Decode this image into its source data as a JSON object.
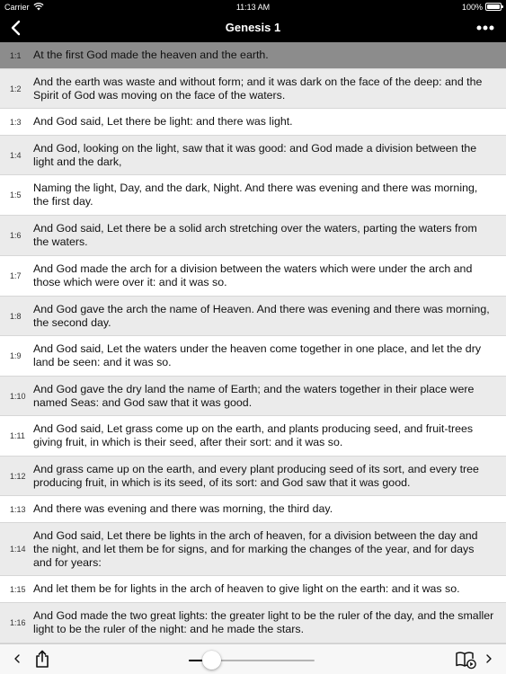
{
  "status_bar": {
    "carrier": "Carrier",
    "time": "11:13 AM",
    "battery": "100%"
  },
  "nav": {
    "title": "Genesis 1",
    "back_icon": "chevron-left-icon",
    "more_icon": "ellipsis-icon"
  },
  "verses": [
    {
      "ref": "1:1",
      "text": "At the first God made the heaven and the earth."
    },
    {
      "ref": "1:2",
      "text": "And the earth was waste and without form; and it was dark on the face of the deep: and the Spirit of God was moving on the face of the waters."
    },
    {
      "ref": "1:3",
      "text": "And God said, Let there be light: and there was light."
    },
    {
      "ref": "1:4",
      "text": "And God, looking on the light, saw that it was good: and God made a division between the light and the dark,"
    },
    {
      "ref": "1:5",
      "text": "Naming the light, Day, and the dark, Night. And there was evening and there was morning, the first day."
    },
    {
      "ref": "1:6",
      "text": "And God said, Let there be a solid arch stretching over the waters, parting the waters from the waters."
    },
    {
      "ref": "1:7",
      "text": "And God made the arch for a division between the waters which were under the arch and those which were over it: and it was so."
    },
    {
      "ref": "1:8",
      "text": "And God gave the arch the name of Heaven. And there was evening and there was morning, the second day."
    },
    {
      "ref": "1:9",
      "text": "And God said, Let the waters under the heaven come together in one place, and let the dry land be seen: and it was so."
    },
    {
      "ref": "1:10",
      "text": "And God gave the dry land the name of Earth; and the waters together in their place were named Seas: and God saw that it was good."
    },
    {
      "ref": "1:11",
      "text": "And God said, Let grass come up on the earth, and plants producing seed, and fruit-trees giving fruit, in which is their seed, after their sort: and it was so."
    },
    {
      "ref": "1:12",
      "text": "And grass came up on the earth, and every plant producing seed of its sort, and every tree producing fruit, in which is its seed, of its sort: and God saw that it was good."
    },
    {
      "ref": "1:13",
      "text": "And there was evening and there was morning, the third day."
    },
    {
      "ref": "1:14",
      "text": "And God said, Let there be lights in the arch of heaven, for a division between the day and the night, and let them be for signs, and for marking the changes of the year, and for days and for years:"
    },
    {
      "ref": "1:15",
      "text": "And let them be for lights in the arch of heaven to give light on the earth: and it was so."
    },
    {
      "ref": "1:16",
      "text": "And God made the two great lights: the greater light to be the ruler of the day, and the smaller light to be the ruler of the night: and he made the stars."
    }
  ],
  "selected_verse": "1:1",
  "toolbar": {
    "slider_value": 0.18,
    "icons": [
      "chevron-left-icon",
      "share-icon",
      "book-audio-icon",
      "chevron-right-icon"
    ]
  },
  "colors": {
    "nav_background": "#000000",
    "selected_row": "#8c8c8c",
    "alternate_row": "#ebebeb"
  }
}
